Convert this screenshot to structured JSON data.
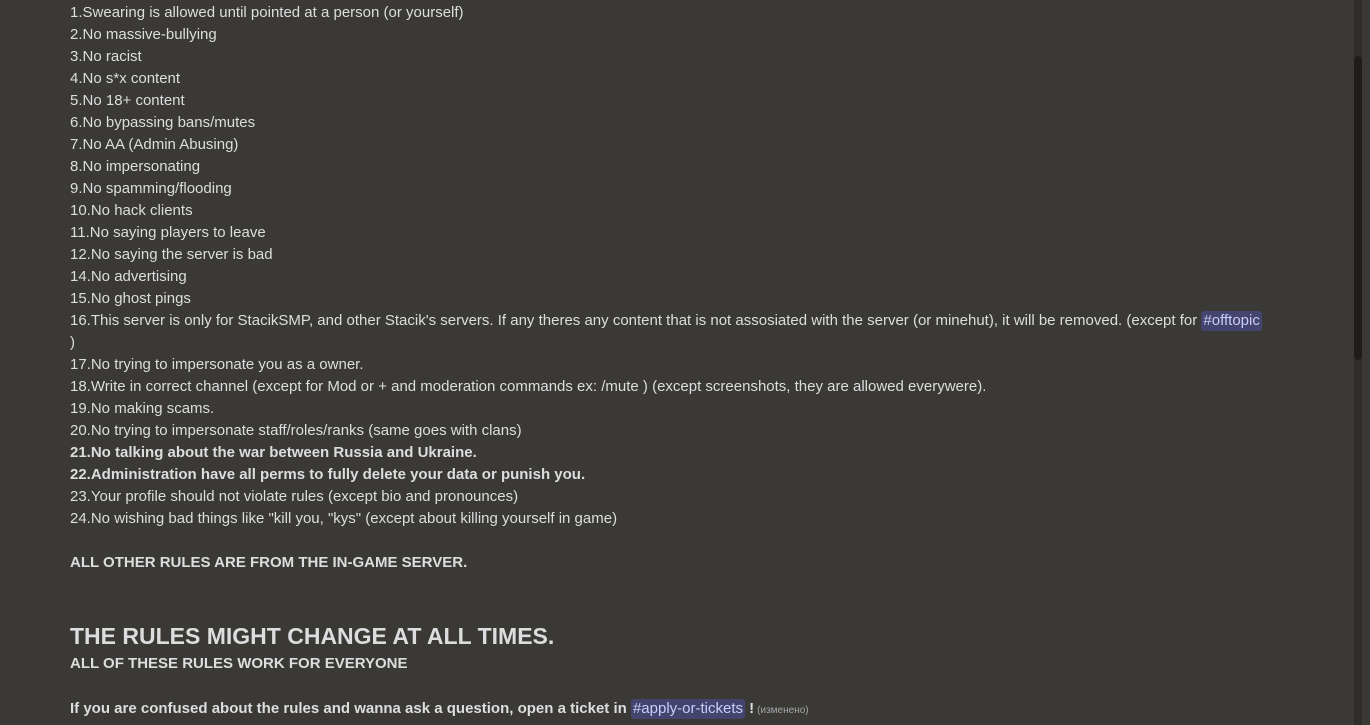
{
  "rules": [
    "1.Swearing is allowed until pointed at a person (or yourself)",
    "2.No massive-bullying",
    "3.No racist",
    "4.No s*x content",
    "5.No 18+ content",
    "6.No bypassing bans/mutes",
    "7.No AA (Admin Abusing)",
    "8.No impersonating",
    "9.No spamming/flooding",
    "10.No hack clients",
    "11.No saying players to leave",
    "12.No saying the server is bad",
    "14.No advertising",
    "15.No ghost pings"
  ],
  "rule16": {
    "text": "16.This server is only for StacikSMP, and other Stacik's servers. If any theres any content that is not assosiated with the server (or minehut), it will be removed. (except for ",
    "mention": "#offtopic",
    "end": ")"
  },
  "rules_b": [
    "17.No trying to impersonate you as a owner.",
    "18.Write in correct channel (except for Mod or + and moderation commands ex: /mute ) (except screenshots, they are allowed everywere).",
    "19.No making scams.",
    "20.No trying to impersonate staff/roles/ranks (same goes with clans)"
  ],
  "bold_rules": [
    "21.No talking about the war between Russia and Ukraine.",
    "22.Administration have all perms to fully delete your data or punish you."
  ],
  "rules_c": [
    "23.Your profile should not violate rules (except bio and pronounces)",
    "24.No wishing bad things like \"kill you, \"kys\" (except about killing yourself in game)"
  ],
  "other_rules": "ALL OTHER RULES ARE FROM THE IN-GAME  SERVER.",
  "heading": "THE RULES MIGHT CHANGE  AT ALL TIMES.",
  "everyone": "ALL OF THESE RULES WORK FOR EVERYONE",
  "ticket": {
    "text": "If you are confused about the rules and wanna ask a question, open a ticket in ",
    "mention": "#apply-or-tickets",
    "end": " !",
    "edited": "(изменено)"
  },
  "colors": {
    "background": "#3b3936",
    "text": "#dcddde",
    "mention_bg": "#4a4f8a",
    "mention_text": "#c9cdfb"
  }
}
